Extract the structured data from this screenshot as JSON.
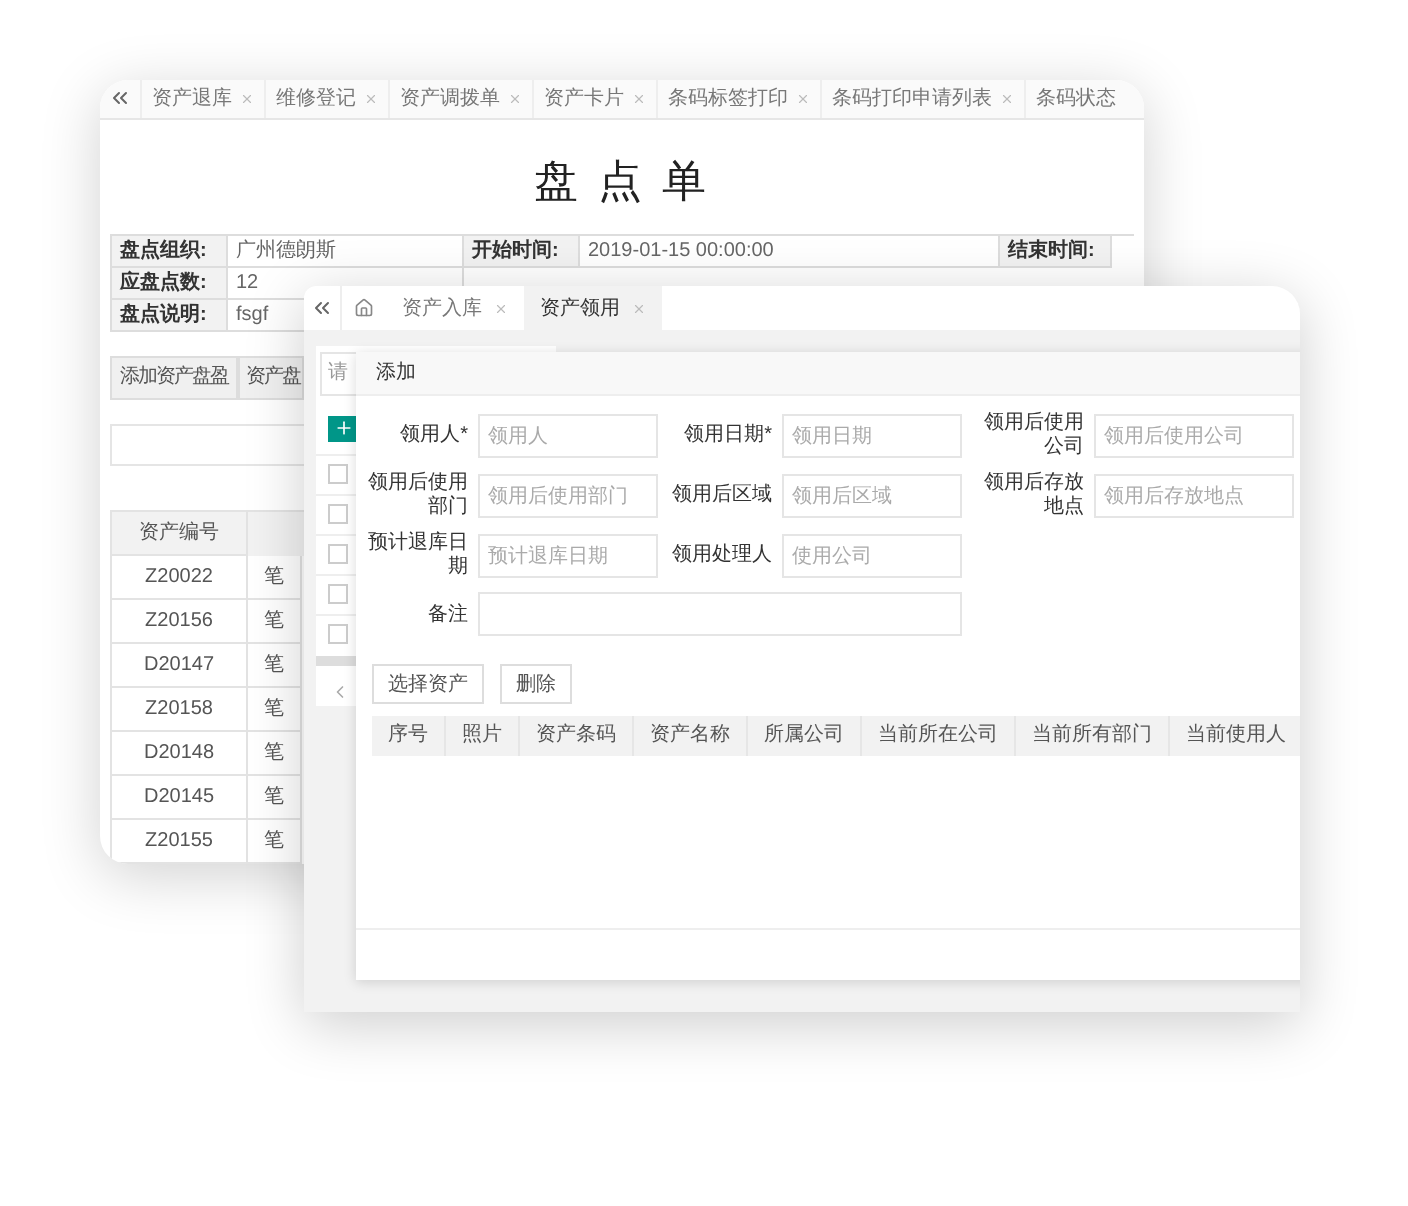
{
  "back_window": {
    "tabs": [
      {
        "label": "资产退库",
        "selected": false
      },
      {
        "label": "维修登记",
        "selected": false
      },
      {
        "label": "资产调拨单",
        "selected": false
      },
      {
        "label": "资产卡片",
        "selected": false
      },
      {
        "label": "条码标签打印",
        "selected": false
      },
      {
        "label": "条码打印申请列表",
        "selected": false
      },
      {
        "label": "条码状态",
        "selected": false
      }
    ],
    "title": "盘 点 单",
    "info_rows": [
      [
        "盘点组织:",
        "广州德朗斯",
        "开始时间:",
        "2019-01-15 00:00:00",
        "结束时间:"
      ],
      [
        "应盘点数:",
        "12"
      ],
      [
        "盘点说明:",
        "fsgf"
      ]
    ],
    "buttons": [
      "添加资产盘盈",
      "资产盘"
    ],
    "table": {
      "columns": [
        "资产编号"
      ],
      "rows": [
        [
          "Z20022",
          "笔"
        ],
        [
          "Z20156",
          "笔"
        ],
        [
          "D20147",
          "笔"
        ],
        [
          "Z20158",
          "笔"
        ],
        [
          "D20148",
          "笔"
        ],
        [
          "D20145",
          "笔"
        ],
        [
          "Z20155",
          "笔"
        ]
      ]
    }
  },
  "front_window": {
    "tabs": [
      {
        "label": "资产入库",
        "selected": false
      },
      {
        "label": "资产领用",
        "selected": true
      }
    ],
    "search": {
      "placeholder": "请"
    },
    "list_rows": [
      {
        "checked": false
      },
      {
        "checked": false
      },
      {
        "checked": false
      },
      {
        "checked": false
      },
      {
        "checked": false
      }
    ],
    "dialog": {
      "title": "添加",
      "fields": [
        {
          "label": "领用人*",
          "placeholder": "领用人"
        },
        {
          "label": "领用日期*",
          "placeholder": "领用日期"
        },
        {
          "label": "领用后使用公司",
          "placeholder": "领用后使用公司"
        },
        {
          "label": "领用后使用部门",
          "placeholder": "领用后使用部门"
        },
        {
          "label": "领用后区域",
          "placeholder": "领用后区域"
        },
        {
          "label": "领用后存放地点",
          "placeholder": "领用后存放地点"
        },
        {
          "label": "预计退库日期",
          "placeholder": "预计退库日期"
        },
        {
          "label": "领用处理人",
          "placeholder": "使用公司"
        }
      ],
      "remark": {
        "label": "备注"
      },
      "buttons": [
        "选择资产",
        "删除"
      ],
      "table_columns": [
        "序号",
        "照片",
        "资产条码",
        "资产名称",
        "所属公司",
        "当前所在公司",
        "当前所有部门",
        "当前使用人"
      ]
    }
  }
}
